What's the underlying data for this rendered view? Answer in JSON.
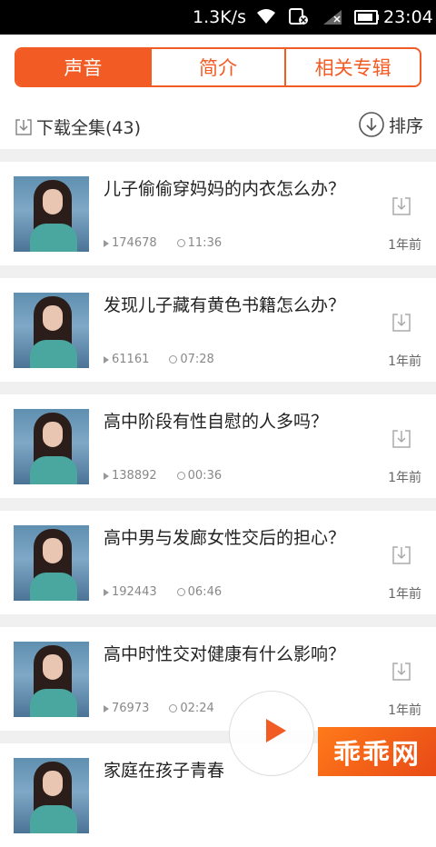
{
  "statusbar": {
    "speed": "1.3K/s",
    "time": "23:04",
    "icons": [
      "wifi-icon",
      "sim-icon",
      "signal-icon",
      "battery-icon"
    ]
  },
  "tabs": [
    {
      "label": "声音",
      "active": true
    },
    {
      "label": "简介",
      "active": false
    },
    {
      "label": "相关专辑",
      "active": false
    }
  ],
  "toolbar": {
    "download_all": "下载全集(43)",
    "sort": "排序"
  },
  "items": [
    {
      "title": "儿子偷偷穿妈妈的内衣怎么办？",
      "plays": "174678",
      "duration": "11:36",
      "ago": "1年前"
    },
    {
      "title": "发现儿子藏有黄色书籍怎么办？",
      "plays": "61161",
      "duration": "07:28",
      "ago": "1年前"
    },
    {
      "title": "高中阶段有性自慰的人多吗？",
      "plays": "138892",
      "duration": "00:36",
      "ago": "1年前"
    },
    {
      "title": "高中男与发廊女性交后的担心？",
      "plays": "192443",
      "duration": "06:46",
      "ago": "1年前"
    },
    {
      "title": "高中时性交对健康有什么影响？",
      "plays": "76973",
      "duration": "02:24",
      "ago": "1年前"
    },
    {
      "title": "家庭在孩子青春",
      "plays": "",
      "duration": "",
      "ago": ""
    }
  ],
  "watermark": "乖乖网",
  "colors": {
    "accent": "#f25b23"
  }
}
